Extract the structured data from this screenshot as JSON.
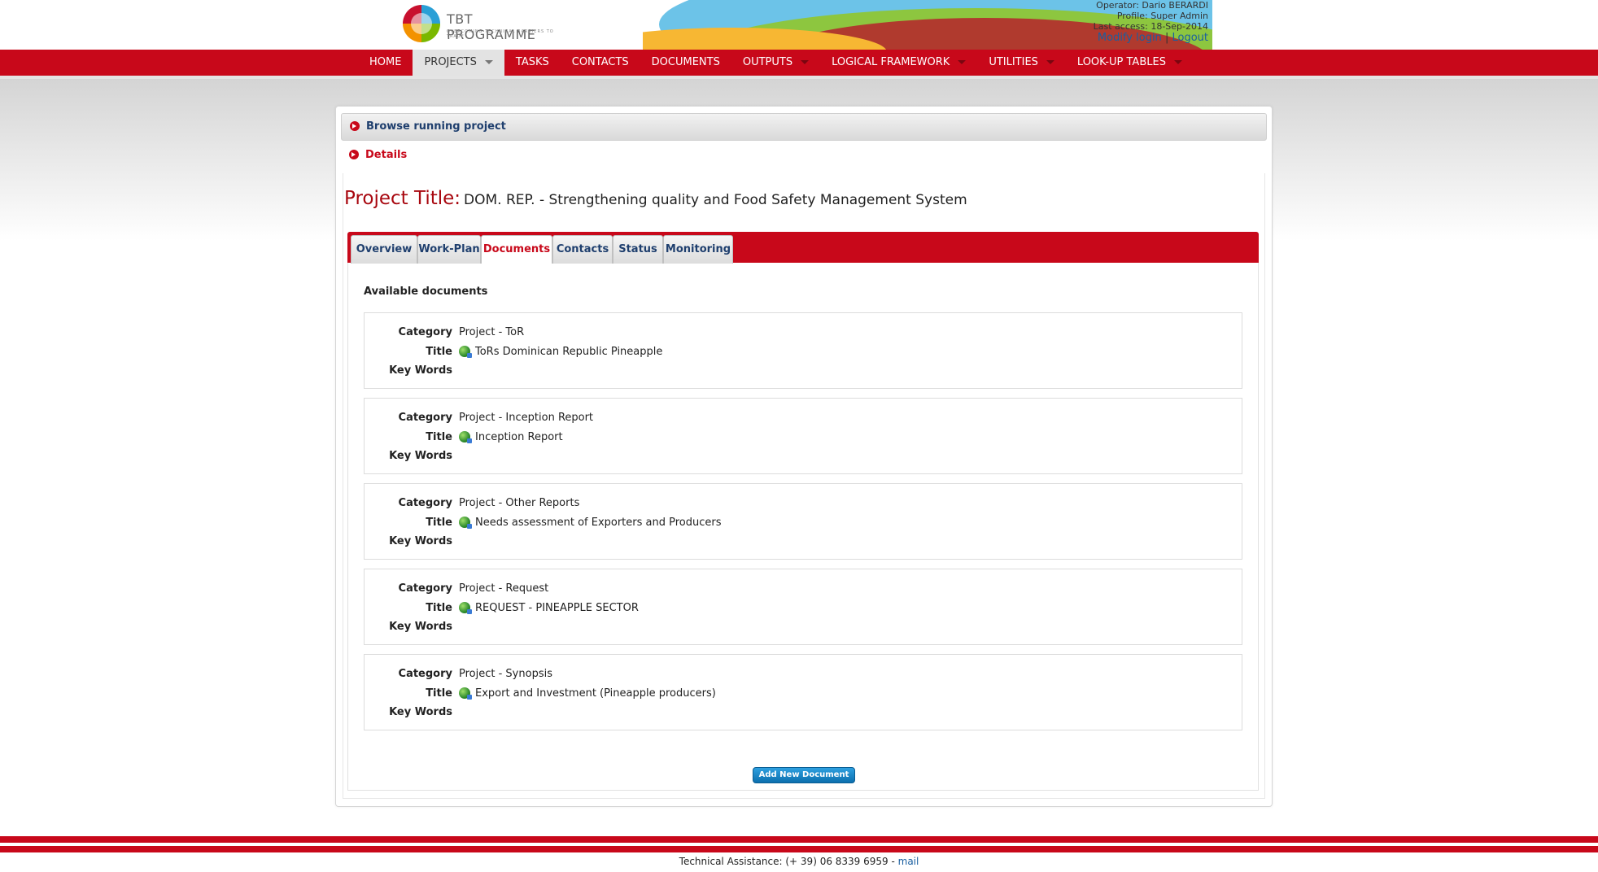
{
  "header": {
    "logo_name": "TBT PROGRAMME",
    "logo_tagline": "OVERCOMING TECHNICAL BARRIERS TO TRADE",
    "operator": "Operator: Dario BERARDI",
    "profile": "Profile: Super Admin",
    "last_access": "Last access: 18-Sep-2014",
    "modify_login": "Modify login",
    "separator": "|",
    "logout": "Logout"
  },
  "nav": {
    "items": [
      {
        "label": "HOME",
        "dropdown": false,
        "active": false
      },
      {
        "label": "PROJECTS",
        "dropdown": true,
        "active": true
      },
      {
        "label": "TASKS",
        "dropdown": false,
        "active": false
      },
      {
        "label": "CONTACTS",
        "dropdown": false,
        "active": false
      },
      {
        "label": "DOCUMENTS",
        "dropdown": false,
        "active": false
      },
      {
        "label": "OUTPUTS",
        "dropdown": true,
        "active": false
      },
      {
        "label": "LOGICAL FRAMEWORK",
        "dropdown": true,
        "active": false
      },
      {
        "label": "UTILITIES",
        "dropdown": true,
        "active": false
      },
      {
        "label": "LOOK-UP TABLES",
        "dropdown": true,
        "active": false
      }
    ]
  },
  "accordion": {
    "browse": "Browse running project",
    "details": "Details"
  },
  "project": {
    "title_label": "Project Title:",
    "title_value": "DOM. REP. - Strengthening quality and Food Safety Management System"
  },
  "tabs": [
    {
      "label": "Overview",
      "active": false
    },
    {
      "label": "Work-Plan",
      "active": false
    },
    {
      "label": "Documents",
      "active": true
    },
    {
      "label": "Contacts",
      "active": false
    },
    {
      "label": "Status",
      "active": false
    },
    {
      "label": "Monitoring",
      "active": false
    }
  ],
  "documents": {
    "heading": "Available documents",
    "field_labels": {
      "category": "Category",
      "title": "Title",
      "keywords": "Key Words"
    },
    "items": [
      {
        "category": "Project - ToR",
        "title": "ToRs Dominican Republic Pineapple",
        "keywords": ""
      },
      {
        "category": "Project - Inception Report",
        "title": "Inception Report",
        "keywords": ""
      },
      {
        "category": "Project - Other Reports",
        "title": "Needs assessment of Exporters and Producers",
        "keywords": ""
      },
      {
        "category": "Project - Request",
        "title": "REQUEST - PINEAPPLE SECTOR",
        "keywords": ""
      },
      {
        "category": "Project - Synopsis",
        "title": "Export and Investment (Pineapple producers)",
        "keywords": ""
      }
    ],
    "add_button": "Add New Document"
  },
  "footer": {
    "text": "Technical Assistance: (+ 39) 06 8339 6959 - ",
    "mail": "mail"
  },
  "colors": {
    "brand_red": "#c8081a",
    "link_blue": "#1a5fa0",
    "tab_text": "#1f3f6e"
  }
}
